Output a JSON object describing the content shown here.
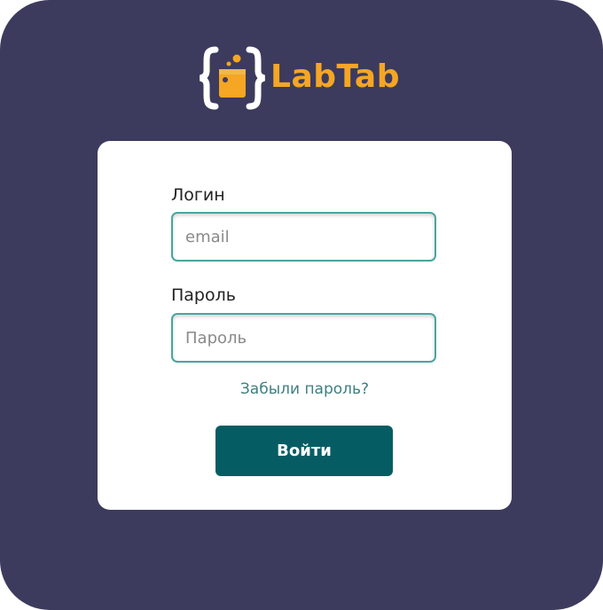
{
  "brand": {
    "name": "LabTab",
    "accent_color": "#f5a623",
    "logo_icon": "flask-braces-icon"
  },
  "login_form": {
    "login_label": "Логин",
    "login_placeholder": "email",
    "password_label": "Пароль",
    "password_placeholder": "Пароль",
    "forgot_link": "Забыли пароль?",
    "submit_label": "Войти"
  },
  "colors": {
    "background": "#3c3b5e",
    "card": "#ffffff",
    "input_border": "#4aa59f",
    "link": "#3f7f80",
    "button": "#055d63"
  }
}
